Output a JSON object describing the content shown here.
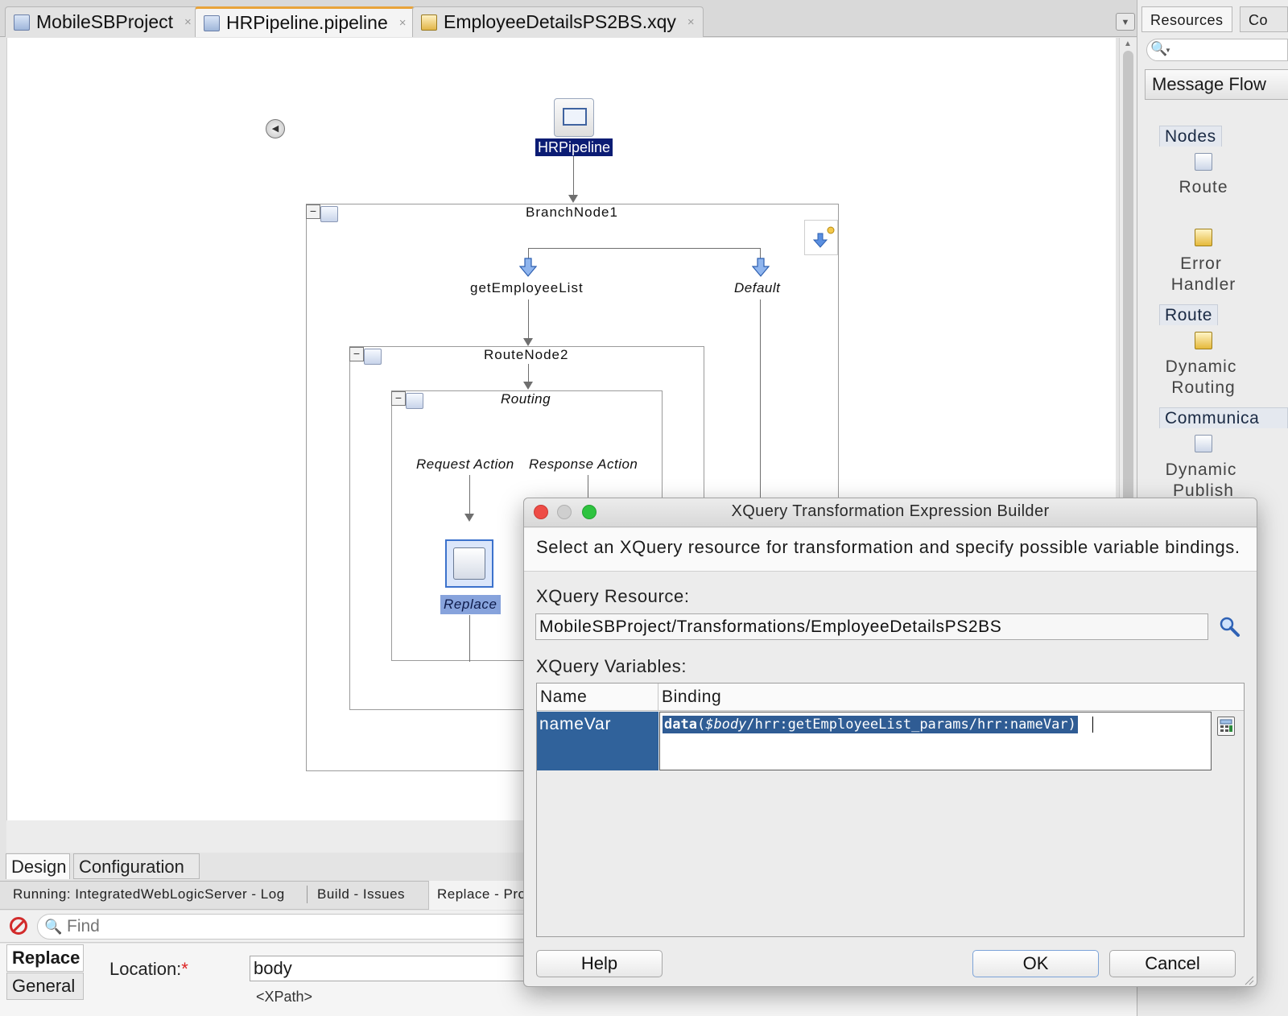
{
  "editor_tabs": [
    {
      "label": "MobileSBProject",
      "icon": "project-icon"
    },
    {
      "label": "HRPipeline.pipeline",
      "icon": "pipeline-icon"
    },
    {
      "label": "EmployeeDetailsPS2BS.xqy",
      "icon": "xquery-file-icon"
    }
  ],
  "tab_close_glyph": "×",
  "canvas": {
    "pipeline_label": "HRPipeline",
    "branch_node": "BranchNode1",
    "branch_get": "getEmployeeList",
    "branch_default": "Default",
    "route_node": "RouteNode2",
    "routing": "Routing",
    "request_action": "Request Action",
    "response_action": "Response Action",
    "replace_label": "Replace",
    "collapse_glyph": "−"
  },
  "view_tabs": [
    {
      "label": "Design",
      "active": true
    },
    {
      "label": "Configuration",
      "active": false
    }
  ],
  "log_tabs": [
    {
      "label": "Running: IntegratedWebLogicServer - Log"
    },
    {
      "label": "Build - Issues"
    },
    {
      "label": "Replace - Pro"
    }
  ],
  "find": {
    "placeholder": "Find"
  },
  "property_panel": {
    "tabs": [
      "Replace",
      "General"
    ],
    "location_label": "Location:",
    "required_mark": "*",
    "location_value": "body",
    "xpath_label": "<XPath>"
  },
  "right_panel": {
    "tabs": [
      "Resources",
      "Co"
    ],
    "dropdown": "Message Flow",
    "sections": {
      "nodes": "Nodes",
      "route": "Route",
      "communication": "Communica"
    },
    "items": {
      "route": "Route",
      "error_handler_1": "Error",
      "error_handler_2": "Handler",
      "dynamic_routing_1": "Dynamic",
      "dynamic_routing_2": "Routing",
      "dynamic_publish_1": "Dynamic",
      "dynamic_publish_2": "Publish"
    }
  },
  "dialog": {
    "title": "XQuery Transformation Expression Builder",
    "description": "Select an XQuery resource for transformation and specify possible variable bindings.",
    "resource_label": "XQuery Resource:",
    "resource_value": "MobileSBProject/Transformations/EmployeeDetailsPS2BS",
    "variables_label": "XQuery Variables:",
    "columns": [
      "Name",
      "Binding"
    ],
    "rows": [
      {
        "name": "nameVar",
        "binding_fn": "data",
        "binding_open": "(",
        "binding_var": "$body",
        "binding_path": "/hrr:getEmployeeList_params/hrr:nameVar",
        "binding_close": ")"
      }
    ],
    "buttons": {
      "help": "Help",
      "ok": "OK",
      "cancel": "Cancel"
    }
  },
  "colors": {
    "selection_blue": "#30629b",
    "pipeline_label_bg": "#0b1c74",
    "close_red": "#ee4c46",
    "maximize_green": "#2ec33f"
  }
}
